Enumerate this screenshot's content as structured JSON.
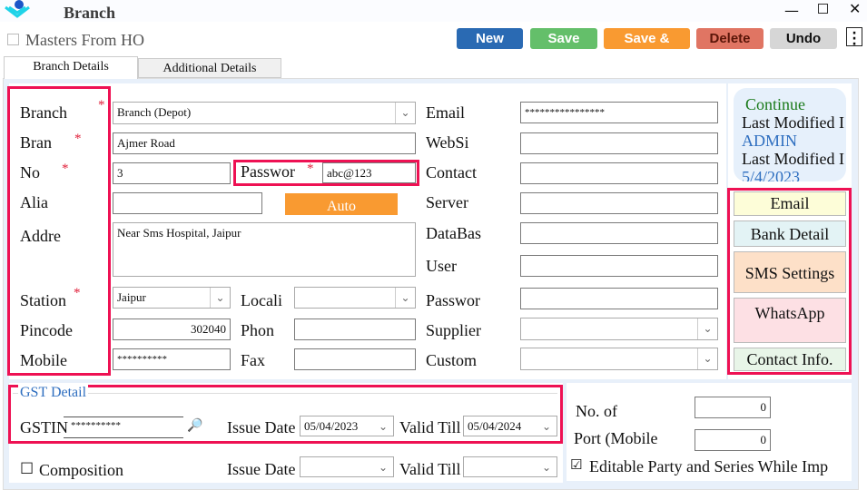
{
  "window": {
    "title": "Branch"
  },
  "masters_from_ho": {
    "label": "Masters From HO",
    "checked": false
  },
  "toolbar": {
    "new": "New",
    "save": "Save",
    "save_and": "Save &",
    "delete": "Delete",
    "undo": "Undo"
  },
  "tabs": [
    {
      "label": "Branch Details",
      "active": true
    },
    {
      "label": "Additional Details",
      "active": false
    }
  ],
  "form": {
    "branch": {
      "label": "Branch",
      "value": "Branch (Depot)"
    },
    "bran": {
      "label": "Bran",
      "value": "Ajmer Road"
    },
    "no": {
      "label": "No",
      "value": "3"
    },
    "password": {
      "label": "Passwor",
      "value": "abc@123"
    },
    "alia": {
      "label": "Alia",
      "value": ""
    },
    "auto": "Auto",
    "addre": {
      "label": "Addre",
      "value": "Near Sms Hospital, Jaipur"
    },
    "station": {
      "label": "Station",
      "value": "Jaipur"
    },
    "locali": {
      "label": "Locali",
      "value": ""
    },
    "pincode": {
      "label": "Pincode",
      "value": "302040"
    },
    "phon": {
      "label": "Phon",
      "value": ""
    },
    "mobile": {
      "label": "Mobile",
      "value": "**********"
    },
    "fax": {
      "label": "Fax",
      "value": ""
    },
    "req": "*"
  },
  "right_form": {
    "email": {
      "label": "Email",
      "value": "****************"
    },
    "website": {
      "label": "WebSi",
      "value": ""
    },
    "contact": {
      "label": "Contact",
      "value": ""
    },
    "server": {
      "label": "Server",
      "value": ""
    },
    "database": {
      "label": "DataBas",
      "value": ""
    },
    "user": {
      "label": "User",
      "value": ""
    },
    "password": {
      "label": "Passwor",
      "value": ""
    },
    "supplier": {
      "label": "Supplier",
      "value": ""
    },
    "custom": {
      "label": "Custom",
      "value": ""
    }
  },
  "info": {
    "status": "Continue",
    "last_modified_by_label": "Last Modified I",
    "last_modified_by": "ADMIN",
    "last_modified_on_label": "Last Modified I",
    "last_modified_on": "5/4/2023"
  },
  "side_buttons": {
    "email": "Email",
    "bank": "Bank Detail",
    "sms": "SMS Settings",
    "whatsapp": "WhatsApp",
    "contact": "Contact Info."
  },
  "gst": {
    "legend": "GST Detail",
    "gstin_label": "GSTIN",
    "gstin": "**********",
    "issue_label": "Issue Date",
    "issue": "05/04/2023",
    "valid_label": "Valid Till",
    "valid": "05/04/2024"
  },
  "composition": {
    "label": "Composition",
    "checked": false,
    "issue_label": "Issue Date",
    "issue": "",
    "valid_label": "Valid Till",
    "valid": ""
  },
  "extra": {
    "no_of_label": "No. of",
    "no_of": "0",
    "port_label": "Port (Mobile",
    "port": "0",
    "editable_label": "Editable Party and Series While Imp",
    "editable_checked": true
  },
  "icons": {
    "check_box": "☐",
    "check_checked": "☑",
    "chevron": "⌄",
    "search": "🔎"
  }
}
